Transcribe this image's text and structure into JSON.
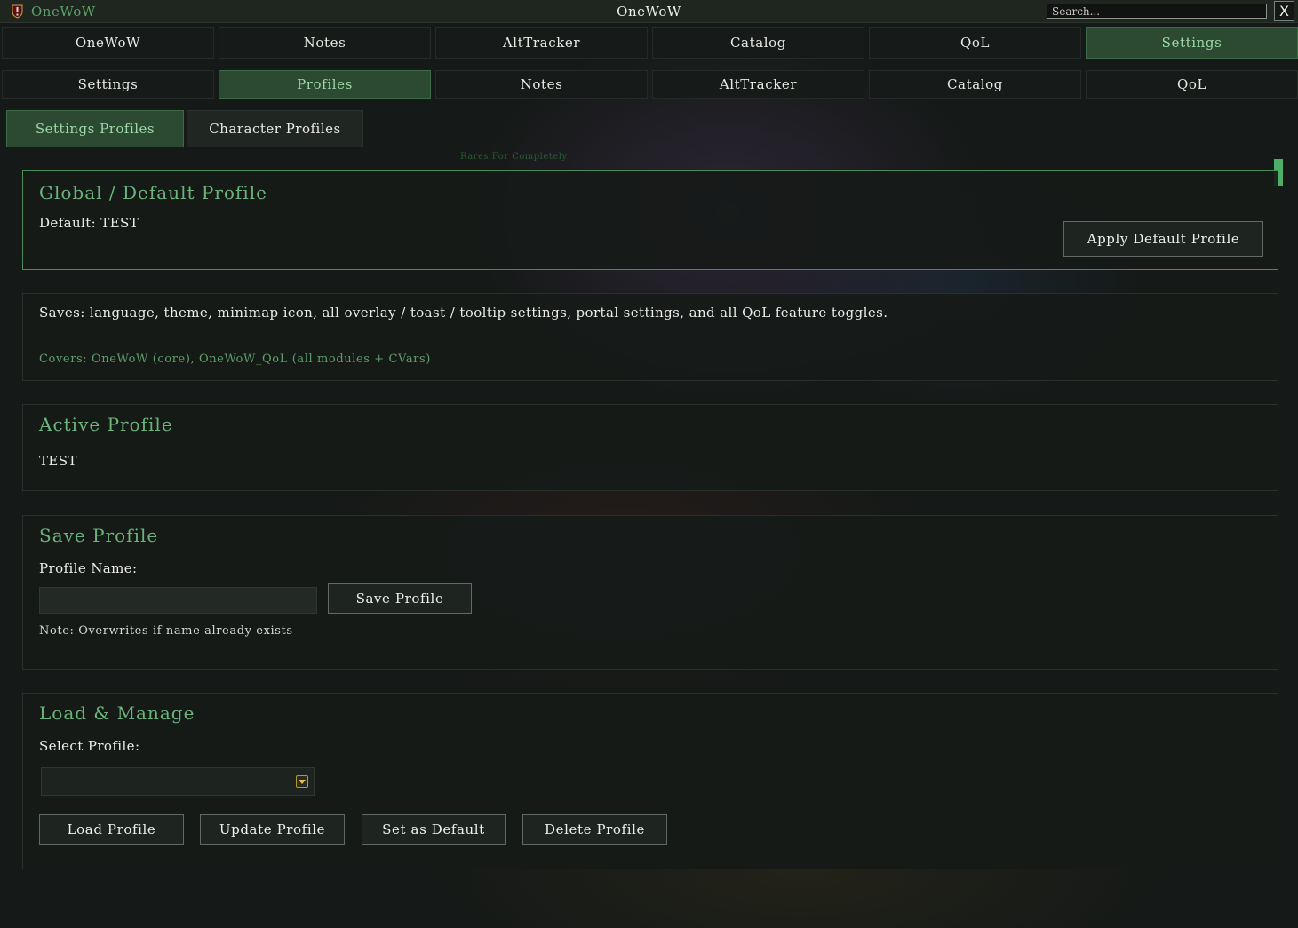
{
  "app": {
    "name": "OneWoW",
    "window_title": "OneWoW",
    "search_placeholder": "Search...",
    "close_label": "X"
  },
  "main_tabs": [
    {
      "label": "OneWoW",
      "active": false
    },
    {
      "label": "Notes",
      "active": false
    },
    {
      "label": "AltTracker",
      "active": false
    },
    {
      "label": "Catalog",
      "active": false
    },
    {
      "label": "QoL",
      "active": false
    },
    {
      "label": "Settings",
      "active": true
    }
  ],
  "sub_tabs": [
    {
      "label": "Settings",
      "active": false
    },
    {
      "label": "Profiles",
      "active": true
    },
    {
      "label": "Notes",
      "active": false
    },
    {
      "label": "AltTracker",
      "active": false
    },
    {
      "label": "Catalog",
      "active": false
    },
    {
      "label": "QoL",
      "active": false
    }
  ],
  "profile_tabs": [
    {
      "label": "Settings Profiles",
      "active": true
    },
    {
      "label": "Character Profiles",
      "active": false
    }
  ],
  "faint_text": "Rares For Completely",
  "global_profile": {
    "title": "Global / Default Profile",
    "default_text": "Default: TEST",
    "apply_button": "Apply Default Profile"
  },
  "info": {
    "saves_text": "Saves: language, theme, minimap icon, all overlay / toast / tooltip settings, portal settings, and all QoL feature toggles.",
    "covers_text": "Covers: OneWoW (core), OneWoW_QoL (all modules + CVars)"
  },
  "active_profile": {
    "title": "Active Profile",
    "value": "TEST"
  },
  "save_profile": {
    "title": "Save Profile",
    "name_label": "Profile Name:",
    "name_value": "",
    "save_button": "Save Profile",
    "note": "Note: Overwrites if name already exists"
  },
  "load_manage": {
    "title": "Load & Manage",
    "select_label": "Select Profile:",
    "selected_value": "",
    "buttons": {
      "load": "Load Profile",
      "update": "Update Profile",
      "set_default": "Set as Default",
      "delete": "Delete Profile"
    }
  },
  "colors": {
    "accent_green": "#6bb37b",
    "active_tab_bg": "#2b4a31",
    "panel_bg": "#161a18"
  }
}
